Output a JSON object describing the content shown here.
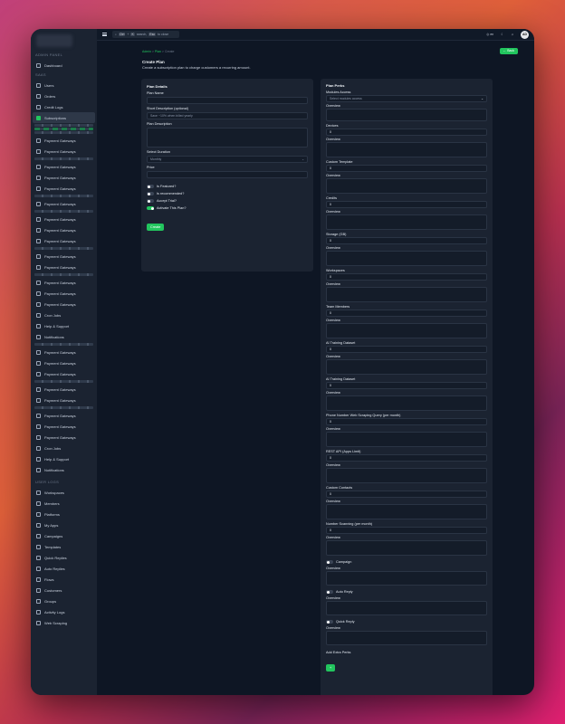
{
  "sidebar": {
    "section_admin": "ADMIN PANEL",
    "dashboard": "Dashboard",
    "section_saas": "SAAS",
    "saas_items": [
      "Users",
      "Orders",
      "Credit Logs",
      "Subscriptions"
    ],
    "middle_items": [
      "Payment Gateways",
      "Payment Gateways",
      "Payment Gateways",
      "Payment Gateways",
      "Payment Gateways",
      "Payment Gateways",
      "Payment Gateways",
      "Payment Gateways",
      "Payment Gateways",
      "Payment Gateways",
      "Payment Gateways",
      "Payment Gateways",
      "Payment Gateways",
      "Payment Gateways",
      "Cron Jobs",
      "Help & Support",
      "Notifications",
      "Payment Gateways",
      "Payment Gateways",
      "Payment Gateways",
      "Payment Gateways",
      "Payment Gateways",
      "Payment Gateways",
      "Payment Gateways",
      "Payment Gateways",
      "Cron Jobs",
      "Help & Support",
      "Notifications"
    ],
    "section_user": "USER LOGS",
    "user_items": [
      "Workspaces",
      "Members",
      "Platforms",
      "My Apps",
      "Campaigns",
      "Templates",
      "Quick Replies",
      "Auto Replies",
      "Flows",
      "Customers",
      "Groups",
      "Activity Logs",
      "Web Scraping"
    ]
  },
  "topbar": {
    "search_prefix": "Ctrl",
    "search_key": "K",
    "search_text": "search,",
    "search_esc": "Esc",
    "search_suffix": "to close",
    "lang": "en",
    "avatar": "AD"
  },
  "breadcrumb": {
    "a": "Admin",
    "b": "Plan",
    "c": "Create"
  },
  "page": {
    "title": "Create Plan",
    "subtitle": "Create a subscription plan to charge customers a recurring amount.",
    "back": "Back"
  },
  "details": {
    "title": "Plan Details",
    "name_label": "Plan Name",
    "short_label": "Short Description (optional)",
    "short_placeholder": "Save ~10% when billed yearly",
    "desc_label": "Plan Description",
    "duration_label": "Select Duration",
    "duration_value": "Monthly",
    "price_label": "Price",
    "toggles": [
      {
        "label": "Is Featured?",
        "on": false
      },
      {
        "label": "Is recommended?",
        "on": false
      },
      {
        "label": "Accept Trial?",
        "on": false
      },
      {
        "label": "Activate This Plan?",
        "on": true
      }
    ],
    "create": "Create"
  },
  "perks": {
    "title": "Plan Perks",
    "modules_label": "Modules Access",
    "modules_placeholder": "Select modules access",
    "overview": "Overview",
    "numeric": [
      {
        "label": "Devices",
        "value": "0"
      },
      {
        "label": "Custom Template",
        "value": "0"
      },
      {
        "label": "Credits",
        "value": "0"
      },
      {
        "label": "Storage (GB)",
        "value": "0"
      },
      {
        "label": "Workspaces",
        "value": "0"
      },
      {
        "label": "Team Members",
        "value": "0"
      },
      {
        "label": "AI Training Dataset",
        "value": "0"
      },
      {
        "label": "AI Training Dataset",
        "value": "0"
      },
      {
        "label": "Phone Number Web Scraping Query (per month)",
        "value": "0"
      },
      {
        "label": "REST API (Apps Limit)",
        "value": "0"
      },
      {
        "label": "Custom Contacts",
        "value": "0"
      },
      {
        "label": "Number Scanning (per month)",
        "value": "0"
      }
    ],
    "toggles": [
      "Campaign",
      "Auto Reply",
      "Quick Reply"
    ],
    "extra_label": "Add Extra Perks",
    "add": "+"
  }
}
